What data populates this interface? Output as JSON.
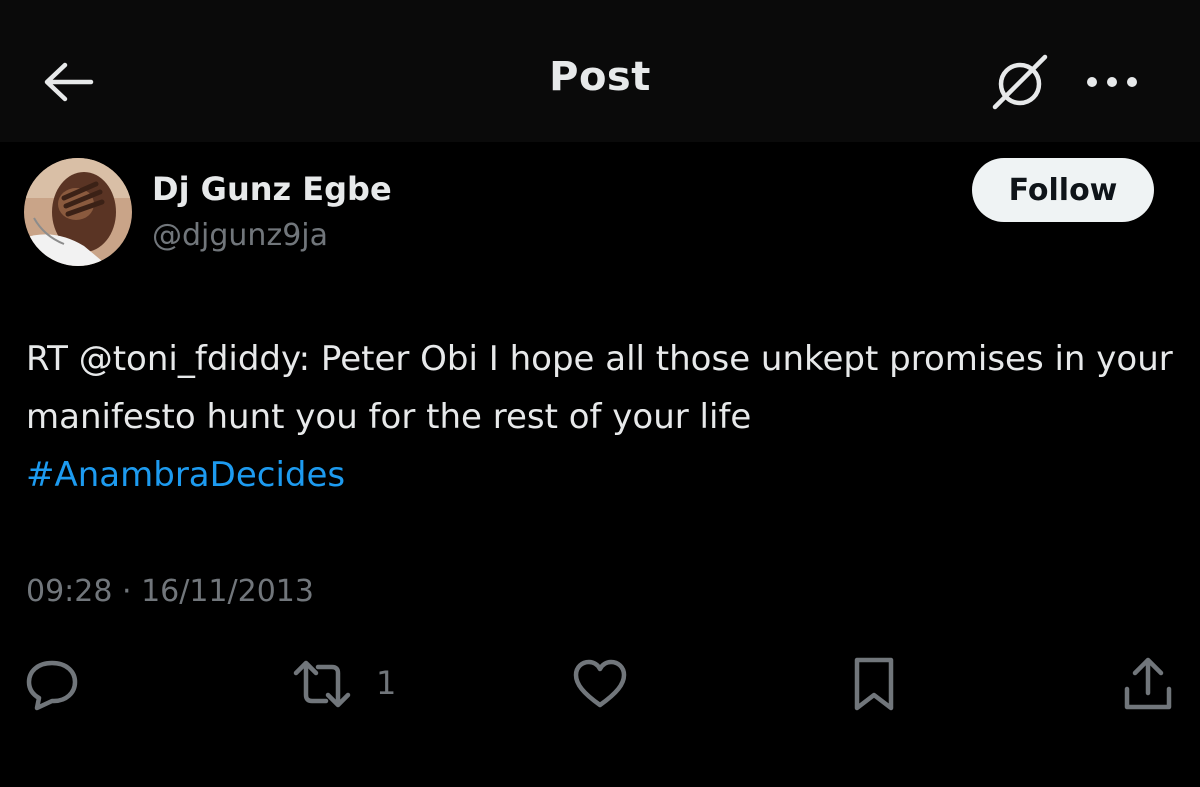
{
  "header": {
    "title": "Post",
    "back_icon": "arrow-left-icon",
    "grok_icon": "grok-icon",
    "more_icon": "more-horizontal-icon"
  },
  "author": {
    "display_name": "Dj Gunz Egbe",
    "handle": "@djgunz9ja",
    "follow_label": "Follow"
  },
  "post": {
    "text": "RT @toni_fdiddy: Peter Obi I hope all those unkept promises in your manifesto hunt you for the rest of your life",
    "hashtag": "#AnambraDecides",
    "timestamp": "09:28 · 16/11/2013"
  },
  "actions": {
    "reply_icon": "reply-icon",
    "retweet_icon": "retweet-icon",
    "retweet_count": "1",
    "like_icon": "heart-icon",
    "bookmark_icon": "bookmark-icon",
    "share_icon": "share-icon"
  },
  "colors": {
    "background": "#000000",
    "text": "#e7e9ea",
    "secondary_text": "#71767b",
    "link": "#1d9bf0",
    "follow_button_bg": "#eff3f4"
  }
}
